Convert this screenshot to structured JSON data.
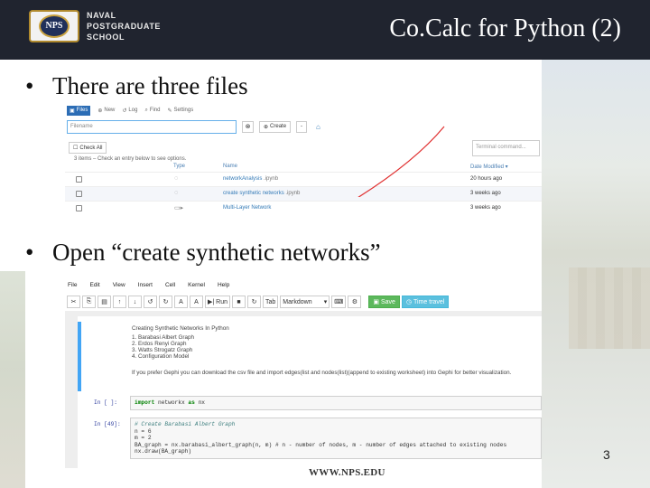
{
  "slide": {
    "title": "Co.Calc for Python (2)",
    "logo_seal": "NPS",
    "logo_text": [
      "NAVAL",
      "POSTGRADUATE",
      "SCHOOL"
    ],
    "bullets": [
      "There are three files",
      "Open “create synthetic networks”"
    ],
    "footer_url": "WWW.NPS.EDU",
    "page_number": "3"
  },
  "file_tree": {
    "tabs": [
      {
        "label": "Files",
        "icon": "folder-icon"
      },
      {
        "label": "New",
        "icon": "plus-circle-icon"
      },
      {
        "label": "Log",
        "icon": "history-icon"
      },
      {
        "label": "Find",
        "icon": "search-icon"
      },
      {
        "label": "Settings",
        "icon": "wrench-icon"
      }
    ],
    "filename_placeholder": "Filename",
    "clear_icon": "close-circle-icon",
    "create_label": "Create",
    "create_menu": "-",
    "home_icon": "home-icon",
    "check_all_label": "Check All",
    "terminal_placeholder": "Terminal command...",
    "items_info": "3 items – Check an entry below to see options.",
    "columns": {
      "type": "Type",
      "name": "Name",
      "date": "Date Modified ▾"
    },
    "rows": [
      {
        "name": "networkAnalysis",
        "ext": ".ipynb",
        "icon": "notebook-icon",
        "date": "20 hours ago"
      },
      {
        "name": "create synthetic networks",
        "ext": ".ipynb",
        "icon": "notebook-icon",
        "date": "3 weeks ago"
      },
      {
        "name": "Multi-Layer Network",
        "ext": "",
        "icon": "folder-icon",
        "date": "3 weeks ago"
      }
    ],
    "annotation_color": "#e03030"
  },
  "notebook": {
    "menu": [
      "File",
      "Edit",
      "View",
      "Insert",
      "Cell",
      "Kernel",
      "Help"
    ],
    "toolbar": {
      "run_label": "Run",
      "cell_type": "Markdown",
      "trusted_label": "Save",
      "timetravel_label": "Time travel",
      "tab_label": "Tab"
    },
    "markdown_cell": {
      "heading": "Creating Synthetic Networks In Python",
      "items": [
        "1. Barabasi Albert Graph",
        "2. Erdos Renyi Graph",
        "3. Watts Strogatz Graph",
        "4. Configuration Model"
      ],
      "paragraph": "If you prefer Gephi you can download the csv file and import edges(list and nodes(list)(append to existing worksheet) into Gephi for better visualization."
    },
    "code_cells": [
      {
        "prompt": "In [ ]:",
        "lines": [
          [
            "kw",
            "import"
          ],
          [
            "",
            " networkx "
          ],
          [
            "kw",
            "as"
          ],
          [
            "",
            " nx"
          ]
        ]
      },
      {
        "prompt": "In [49]:",
        "lines": [
          "# Create Barabasi Albert Graph",
          "n = 6",
          "m = 2",
          "BA_graph = nx.barabasi_albert_graph(n, m) # n - number of nodes, m - number of edges attached to existing nodes",
          "nx.draw(BA_graph)"
        ]
      }
    ]
  }
}
